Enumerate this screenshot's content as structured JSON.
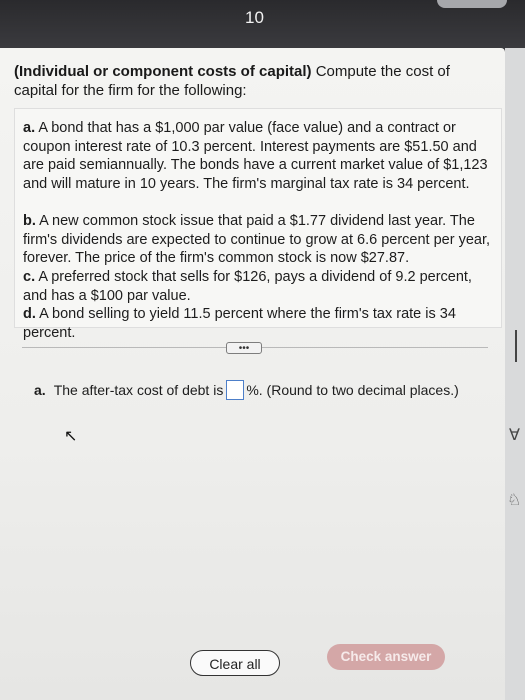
{
  "page_number": "10",
  "heading": {
    "bold": "(Individual or component costs of capital)",
    "text": " Compute the cost of capital for the firm for the following:"
  },
  "problems": [
    {
      "label": "a.",
      "text": " A bond that has a $1,000 par value (face value) and a contract or coupon interest rate of 10.3 percent. Interest payments are $51.50 and are paid semiannually. The bonds have a current market value of $1,123 and will mature in 10 years. The firm's marginal tax rate is 34 percent."
    },
    {
      "label": "b.",
      "text": " A new common stock issue that paid a $1.77 dividend last year. The firm's dividends are expected to continue to grow at 6.6 percent per year, forever. The price of the firm's common stock is now $27.87."
    },
    {
      "label": "c.",
      "text": " A preferred stock that sells for $126, pays a dividend of 9.2 percent, and has a $100 par value."
    },
    {
      "label": "d.",
      "text": " A bond selling to yield 11.5 percent where the firm's tax rate is 34 percent."
    }
  ],
  "more_button": "•••",
  "answer": {
    "label": "a.",
    "prefix": "The after-tax cost of debt is",
    "value": "",
    "suffix": "%. (Round to two decimal places.)"
  },
  "buttons": {
    "clear": "Clear all",
    "check": "Check answer"
  },
  "colors": {
    "check_button": "#d4a7a7",
    "input_border": "#4d7fc9"
  }
}
